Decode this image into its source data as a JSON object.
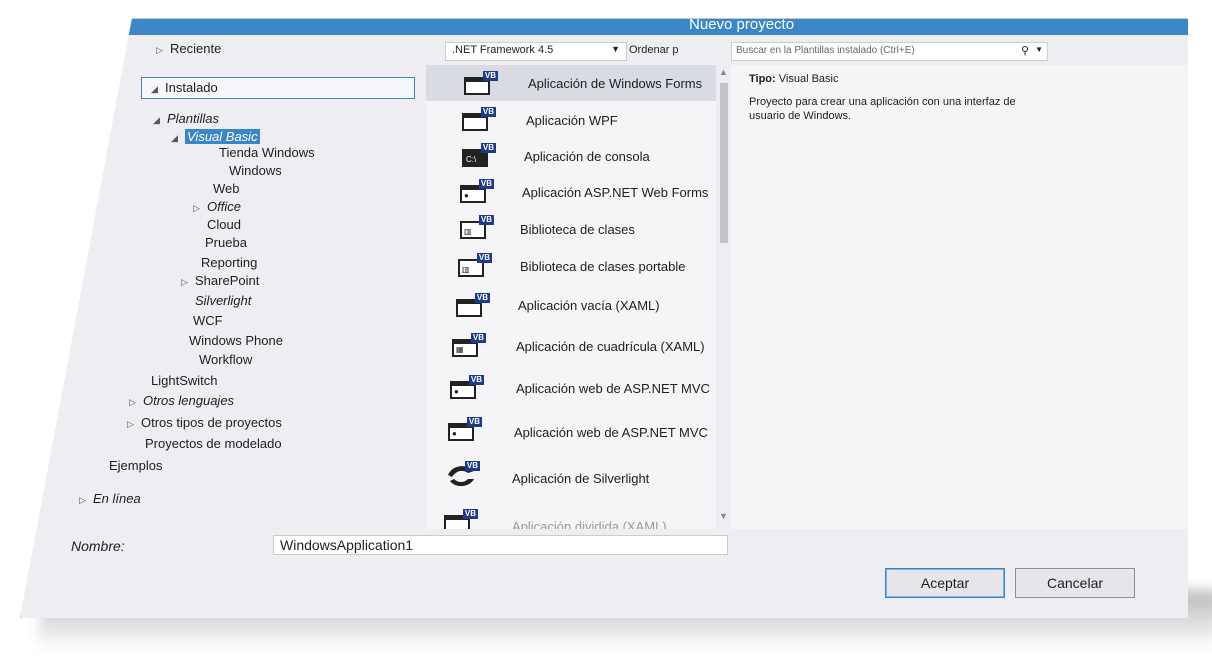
{
  "window": {
    "title": "Nuevo proyecto"
  },
  "tree": {
    "reciente": "Reciente",
    "instalado": "Instalado",
    "plantillas": "Plantillas",
    "visual_basic": "Visual Basic",
    "items": {
      "tienda_windows": "Tienda Windows",
      "windows": "Windows",
      "web": "Web",
      "office": "Office",
      "cloud": "Cloud",
      "prueba": "Prueba",
      "reporting": "Reporting",
      "sharepoint": "SharePoint",
      "silverlight": "Silverlight",
      "wcf": "WCF",
      "windows_phone": "Windows Phone",
      "workflow": "Workflow"
    },
    "lightswitch": "LightSwitch",
    "otros_lenguajes": "Otros lenguajes",
    "otros_tipos": "Otros tipos de proyectos",
    "modelado": "Proyectos de modelado",
    "ejemplos": "Ejemplos",
    "en_linea": "En línea"
  },
  "toolbar": {
    "framework": ".NET Framework 4.5",
    "sort_label": "Ordenar p"
  },
  "search": {
    "placeholder": "Buscar en la Plantillas instalado (Ctrl+E)"
  },
  "templates": [
    {
      "label": "Aplicación de Windows Forms",
      "icon": "windows-forms-icon"
    },
    {
      "label": "Aplicación WPF",
      "icon": "wpf-icon"
    },
    {
      "label": "Aplicación de consola",
      "icon": "console-icon"
    },
    {
      "label": "Aplicación ASP.NET Web Forms",
      "icon": "aspnet-icon"
    },
    {
      "label": "Biblioteca de clases",
      "icon": "class-library-icon"
    },
    {
      "label": "Biblioteca de clases portable",
      "icon": "portable-library-icon"
    },
    {
      "label": "Aplicación vacía (XAML)",
      "icon": "blank-app-icon"
    },
    {
      "label": "Aplicación de cuadrícula (XAML)",
      "icon": "grid-app-icon"
    },
    {
      "label": "Aplicación web de ASP.NET MVC",
      "icon": "mvc-icon"
    },
    {
      "label": "Aplicación web de ASP.NET MVC",
      "icon": "mvc-icon"
    },
    {
      "label": "Aplicación de Silverlight",
      "icon": "silverlight-icon"
    },
    {
      "label": "Aplicación dividida (XAML)",
      "icon": "split-app-icon"
    }
  ],
  "details": {
    "type_label": "Tipo:",
    "type_value": "Visual Basic",
    "description": "Proyecto para crear una aplicación con una interfaz de usuario de Windows."
  },
  "form": {
    "name_label": "Nombre:",
    "name_value": "WindowsApplication1"
  },
  "buttons": {
    "ok": "Aceptar",
    "cancel": "Cancelar"
  },
  "colors": {
    "accent": "#3b86c7",
    "vb_badge": "#1e3a8a"
  }
}
